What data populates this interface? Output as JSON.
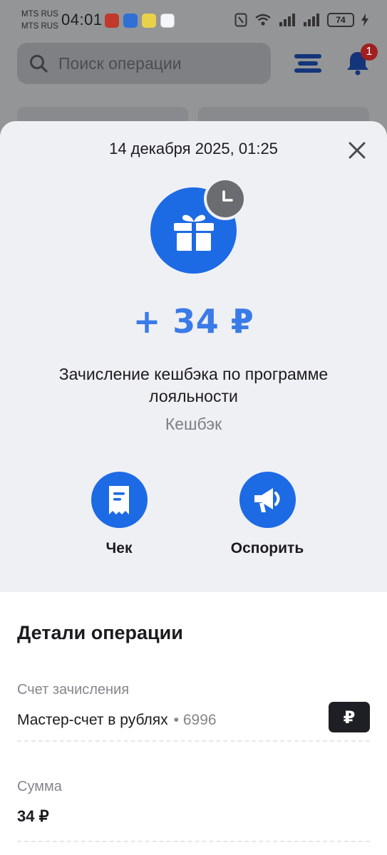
{
  "status_bar": {
    "carrier_1": "MTS RUS",
    "carrier_2": "MTS RUS",
    "time": "04:01",
    "battery": "74"
  },
  "header": {
    "search_placeholder": "Поиск операции",
    "notification_count": "1"
  },
  "sheet": {
    "datetime": "14 декабря 2025, 01:25",
    "amount": "+ 34 ₽",
    "description": "Зачисление кешбэка по программе лояльности",
    "category": "Кешбэк",
    "actions": [
      {
        "label": "Чек",
        "icon": "receipt-icon"
      },
      {
        "label": "Оспорить",
        "icon": "megaphone-icon"
      }
    ]
  },
  "details": {
    "title": "Детали операции",
    "account_label": "Счет зачисления",
    "account_name": "Мастер-счет в рублях",
    "account_mask": "• 6996",
    "currency_symbol": "₽",
    "sum_label": "Сумма",
    "sum_value": "34 ₽"
  },
  "colors": {
    "accent_blue": "#1d6ae5",
    "amount_blue": "#3a7be8",
    "sheet_bg": "#eff0f4",
    "badge_red": "#a0201f"
  }
}
